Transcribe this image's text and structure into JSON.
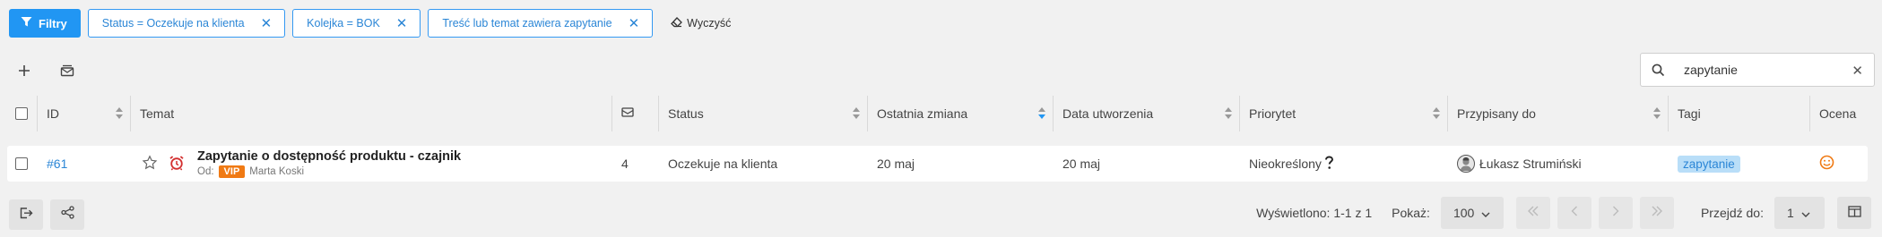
{
  "filters": {
    "button_label": "Filtry",
    "chips": [
      {
        "label": "Status = Oczekuje na klienta"
      },
      {
        "label": "Kolejka = BOK"
      },
      {
        "label": "Treść lub temat zawiera zapytanie"
      }
    ],
    "clear_label": "Wyczyść"
  },
  "search": {
    "value": "zapytanie"
  },
  "columns": {
    "id": "ID",
    "subject": "Temat",
    "status": "Status",
    "last_change": "Ostatnia zmiana",
    "created": "Data utworzenia",
    "priority": "Priorytet",
    "assigned": "Przypisany do",
    "tags": "Tagi",
    "rating": "Ocena"
  },
  "row": {
    "id": "#61",
    "subject": "Zapytanie o dostępność produktu - czajnik",
    "from_label": "Od:",
    "vip_badge": "VIP",
    "from_name": "Marta Koski",
    "message_count": "4",
    "status": "Oczekuje na klienta",
    "last_change": "20 maj",
    "created": "20 maj",
    "priority": "Nieokreślony",
    "assigned": "Łukasz Strumiński",
    "tag": "zapytanie"
  },
  "footer": {
    "displayed": "Wyświetlono: 1-1 z 1",
    "show_label": "Pokaż:",
    "page_size": "100",
    "goto_label": "Przejdź do:",
    "goto_page": "1"
  },
  "colors": {
    "accent": "#2196f3",
    "vip": "#f07a14",
    "alarm": "#d32f2f",
    "rating": "#f07a14"
  }
}
